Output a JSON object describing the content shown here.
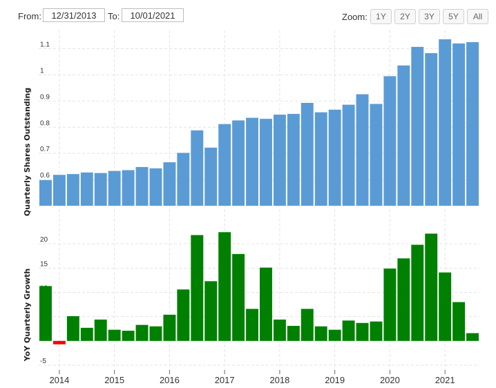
{
  "toolbar": {
    "from_label": "From:",
    "from_value": "12/31/2013",
    "to_label": "To:",
    "to_value": "10/01/2021",
    "zoom_label": "Zoom:",
    "zoom_options": [
      "1Y",
      "2Y",
      "3Y",
      "5Y",
      "All"
    ]
  },
  "colors": {
    "shares": "#5b9bd5",
    "growth_positive": "#008000",
    "growth_negative": "#ff0000",
    "grid": "#e3e3e3"
  },
  "chart_data": [
    {
      "type": "bar",
      "ylabel": "Quarterly Shares Outstanding",
      "ylim": [
        0.5,
        1.17
      ],
      "yticks": [
        0.5,
        0.6,
        0.7,
        0.8,
        0.9,
        1.0,
        1.1
      ],
      "grid": true,
      "x_ticks": [
        "2014",
        "2015",
        "2016",
        "2017",
        "2018",
        "2019",
        "2020",
        "2021"
      ],
      "x": [
        "2013-12-31",
        "2014-03-31",
        "2014-06-30",
        "2014-09-30",
        "2014-12-31",
        "2015-03-31",
        "2015-06-30",
        "2015-09-30",
        "2015-12-31",
        "2016-03-31",
        "2016-06-30",
        "2016-09-30",
        "2016-12-31",
        "2017-03-31",
        "2017-06-30",
        "2017-09-30",
        "2017-12-31",
        "2018-03-31",
        "2018-06-30",
        "2018-09-30",
        "2018-12-31",
        "2019-03-31",
        "2019-06-30",
        "2019-09-30",
        "2019-12-31",
        "2020-03-31",
        "2020-06-30",
        "2020-09-30",
        "2020-12-31",
        "2021-03-31",
        "2021-06-30",
        "2021-09-30"
      ],
      "values": [
        0.598,
        0.618,
        0.621,
        0.627,
        0.625,
        0.633,
        0.636,
        0.648,
        0.643,
        0.666,
        0.702,
        0.788,
        0.722,
        0.812,
        0.826,
        0.836,
        0.832,
        0.848,
        0.851,
        0.893,
        0.857,
        0.867,
        0.886,
        0.926,
        0.889,
        0.995,
        1.036,
        1.107,
        1.083,
        1.136,
        1.12,
        1.125
      ]
    },
    {
      "type": "bar",
      "ylabel": "YoY Quarterly Growth",
      "ylim": [
        -6,
        25
      ],
      "yticks": [
        -5,
        0,
        5,
        10,
        15,
        20
      ],
      "grid": true,
      "x_ticks": [
        "2014",
        "2015",
        "2016",
        "2017",
        "2018",
        "2019",
        "2020",
        "2021"
      ],
      "x": [
        "2013-12-31",
        "2014-03-31",
        "2014-06-30",
        "2014-09-30",
        "2014-12-31",
        "2015-03-31",
        "2015-06-30",
        "2015-09-30",
        "2015-12-31",
        "2016-03-31",
        "2016-06-30",
        "2016-09-30",
        "2016-12-31",
        "2017-03-31",
        "2017-06-30",
        "2017-09-30",
        "2017-12-31",
        "2018-03-31",
        "2018-06-30",
        "2018-09-30",
        "2018-12-31",
        "2019-03-31",
        "2019-06-30",
        "2019-09-30",
        "2019-12-31",
        "2020-03-31",
        "2020-06-30",
        "2020-09-30",
        "2020-12-31",
        "2021-03-31",
        "2021-06-30",
        "2021-09-30"
      ],
      "values": [
        11.3,
        -0.7,
        5.1,
        2.7,
        4.4,
        2.3,
        2.1,
        3.3,
        3.0,
        5.4,
        10.6,
        21.8,
        12.3,
        22.4,
        17.9,
        6.6,
        15.1,
        4.4,
        3.1,
        6.6,
        3.0,
        2.3,
        4.2,
        3.7,
        4.0,
        14.9,
        17.0,
        19.8,
        22.1,
        14.1,
        8.0,
        1.6
      ]
    }
  ]
}
